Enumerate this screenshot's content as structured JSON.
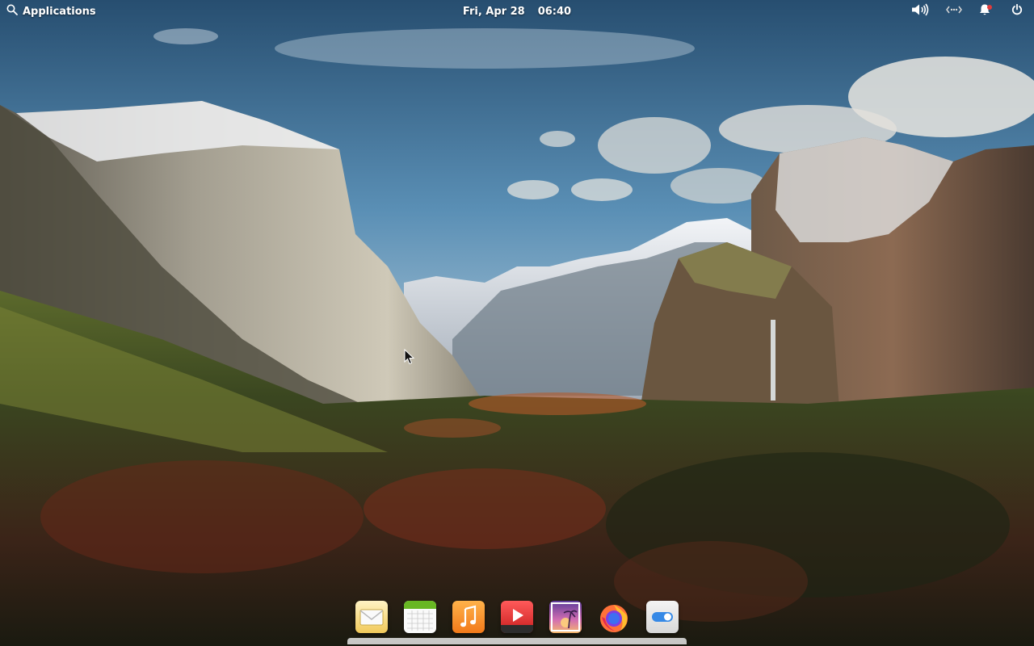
{
  "panel": {
    "applications_label": "Applications",
    "date": "Fri, Apr 28",
    "time": "06:40",
    "indicators": {
      "sound": "volume-icon",
      "network": "network-icon",
      "notifications": "notifications-bell-icon",
      "power": "power-icon"
    }
  },
  "dock": {
    "items": [
      {
        "name": "Mail",
        "icon": "mail-icon"
      },
      {
        "name": "Calendar",
        "icon": "calendar-icon"
      },
      {
        "name": "Music",
        "icon": "music-icon"
      },
      {
        "name": "Videos",
        "icon": "video-player-icon"
      },
      {
        "name": "Photos",
        "icon": "photos-icon"
      },
      {
        "name": "Firefox",
        "icon": "firefox-icon"
      },
      {
        "name": "System Settings",
        "icon": "settings-toggle-icon"
      }
    ]
  },
  "colors": {
    "panel_text": "#ffffff",
    "notification_dot": "#e23b3b",
    "sky_top": "#2d5a7e",
    "forest": "#2e3a1c"
  }
}
